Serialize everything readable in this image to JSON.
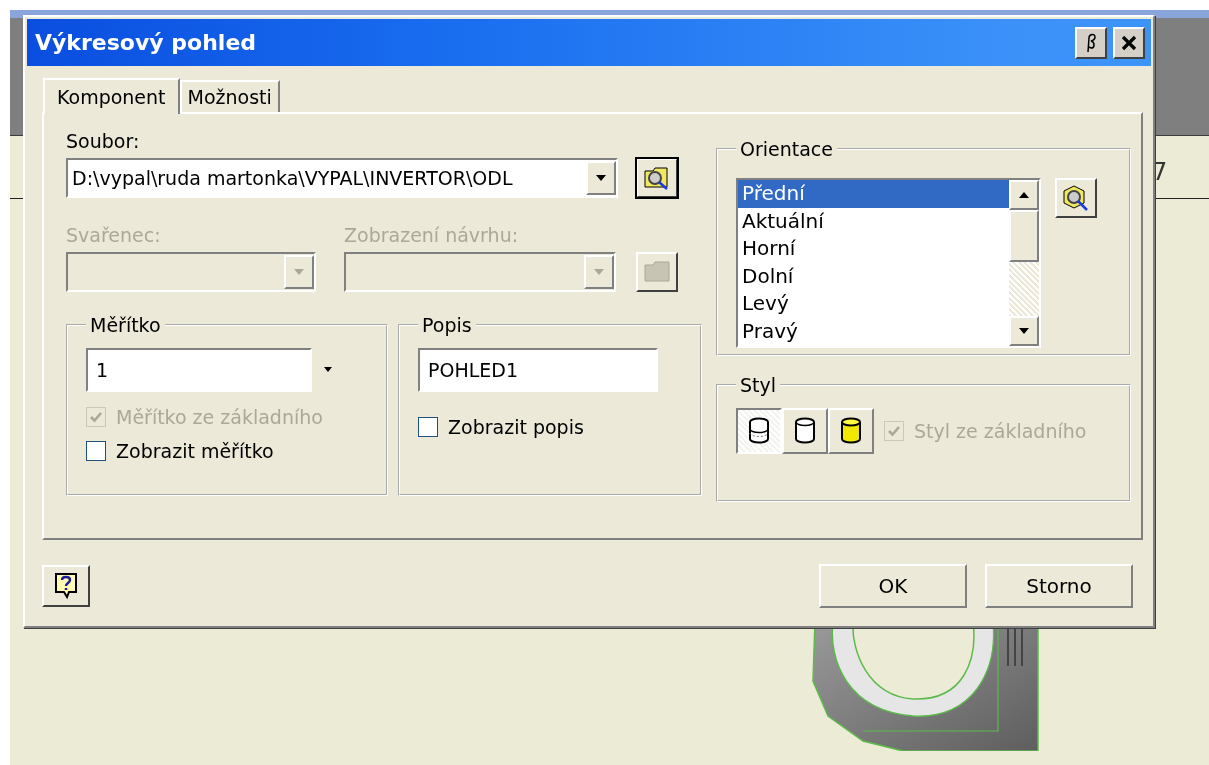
{
  "background": {
    "label": "7"
  },
  "window": {
    "title": "Výkresový pohled"
  },
  "tabs": [
    {
      "label": "Komponent",
      "selected": true
    },
    {
      "label": "Možnosti",
      "selected": false
    }
  ],
  "file": {
    "label": "Soubor:",
    "value": "D:\\vypal\\ruda martonka\\VYPAL\\INVERTOR\\ODL"
  },
  "weldment": {
    "label": "Svařenec:",
    "disabled": true
  },
  "design_view": {
    "label": "Zobrazení návrhu:",
    "disabled": true
  },
  "scale": {
    "title": "Měřítko",
    "value": "1",
    "checkboxes": [
      {
        "label": "Měřítko ze základního",
        "checked": true,
        "disabled": true
      },
      {
        "label": "Zobrazit měřítko",
        "checked": false,
        "disabled": false
      }
    ]
  },
  "caption": {
    "title": "Popis",
    "value": "POHLED1",
    "checkbox": {
      "label": "Zobrazit popis",
      "checked": false,
      "disabled": false
    }
  },
  "orientation": {
    "title": "Orientace",
    "items": [
      {
        "label": "Přední",
        "selected": true
      },
      {
        "label": "Aktuální",
        "selected": false
      },
      {
        "label": "Horní",
        "selected": false
      },
      {
        "label": "Dolní",
        "selected": false
      },
      {
        "label": "Levý",
        "selected": false
      },
      {
        "label": "Pravý",
        "selected": false
      }
    ]
  },
  "style": {
    "title": "Styl",
    "buttons": [
      {
        "kind": "hidden-lines",
        "selected": true
      },
      {
        "kind": "hidden-removed",
        "selected": false
      },
      {
        "kind": "shaded",
        "selected": false
      }
    ],
    "checkbox": {
      "label": "Styl ze základního",
      "checked": true,
      "disabled": true
    }
  },
  "buttons": [
    "OK",
    "Storno"
  ]
}
